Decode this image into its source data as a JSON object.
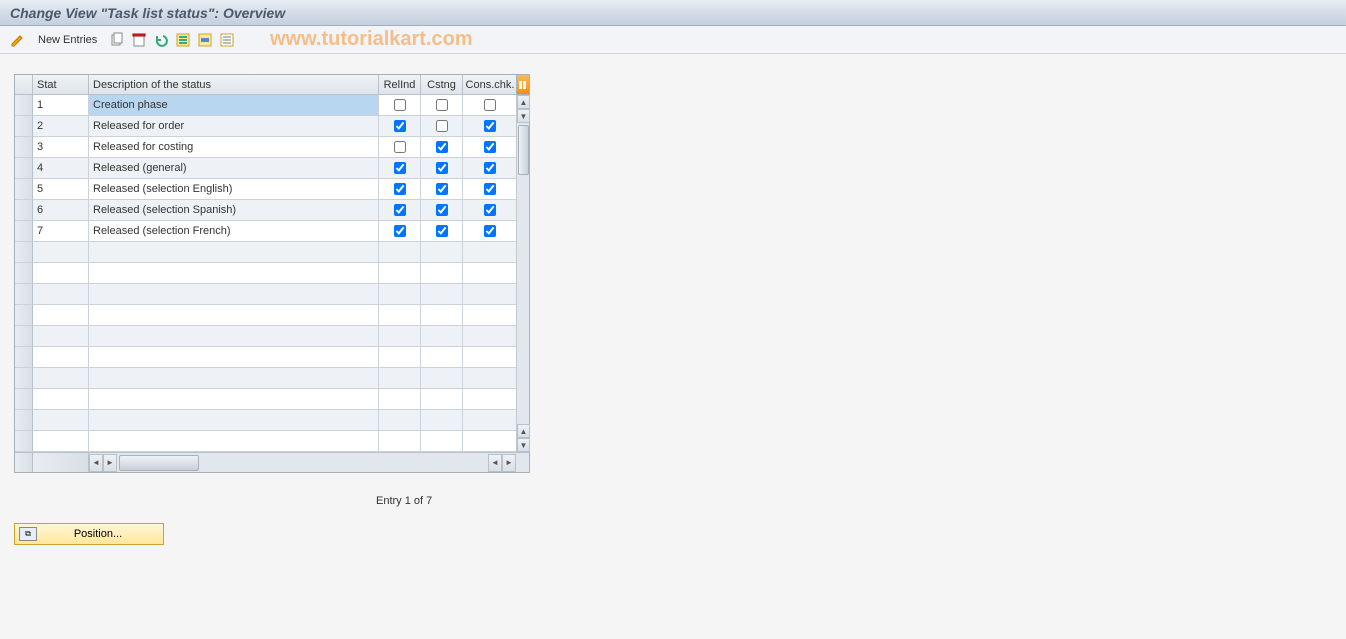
{
  "title": "Change View \"Task list status\": Overview",
  "watermark": "www.tutorialkart.com",
  "toolbar": {
    "new_entries": "New Entries"
  },
  "columns": {
    "stat": "Stat",
    "desc": "Description of the status",
    "relind": "RelInd",
    "cstng": "Cstng",
    "conschk": "Cons.chk."
  },
  "rows": [
    {
      "stat": "1",
      "desc": "Creation phase",
      "relind": false,
      "cstng": false,
      "conschk": false,
      "selected": true
    },
    {
      "stat": "2",
      "desc": "Released for order",
      "relind": true,
      "cstng": false,
      "conschk": true,
      "selected": false
    },
    {
      "stat": "3",
      "desc": "Released for costing",
      "relind": false,
      "cstng": true,
      "conschk": true,
      "selected": false
    },
    {
      "stat": "4",
      "desc": "Released (general)",
      "relind": true,
      "cstng": true,
      "conschk": true,
      "selected": false
    },
    {
      "stat": "5",
      "desc": "Released (selection English)",
      "relind": true,
      "cstng": true,
      "conschk": true,
      "selected": false
    },
    {
      "stat": "6",
      "desc": "Released (selection Spanish)",
      "relind": true,
      "cstng": true,
      "conschk": true,
      "selected": false
    },
    {
      "stat": "7",
      "desc": "Released (selection French)",
      "relind": true,
      "cstng": true,
      "conschk": true,
      "selected": false
    }
  ],
  "empty_rows": 10,
  "footer": {
    "entry_text": "Entry 1 of 7",
    "position_btn": "Position..."
  }
}
